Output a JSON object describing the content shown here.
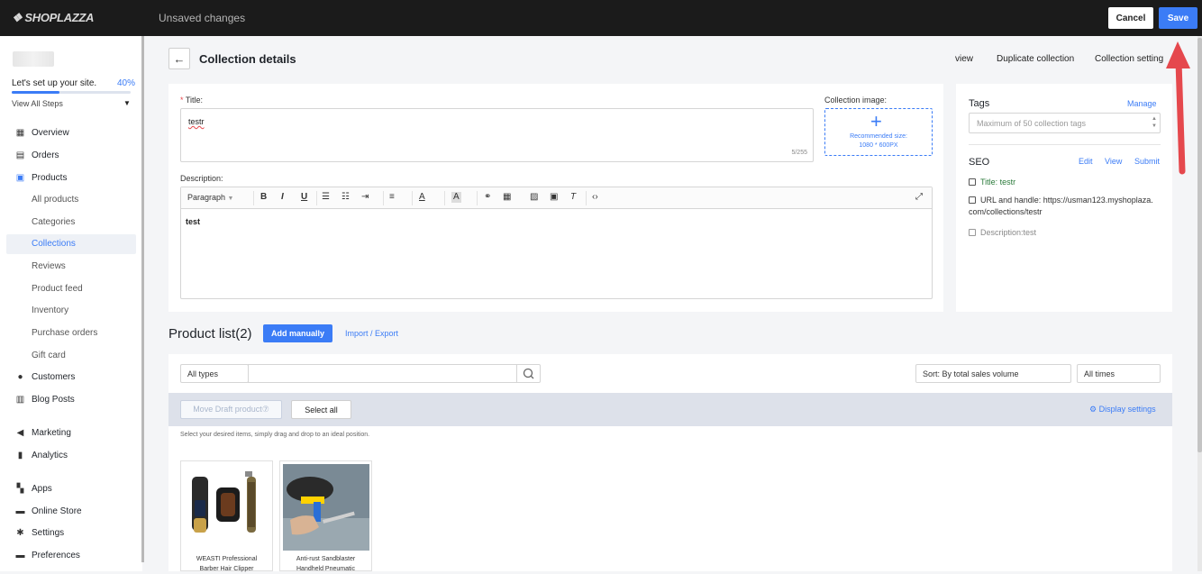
{
  "topbar": {
    "logo": "SHOPLAZZA",
    "status": "Unsaved changes",
    "cancel_label": "Cancel",
    "save_label": "Save",
    "accent": "#3b7cf6"
  },
  "sidebar": {
    "setup_text": "Let's set up your site.",
    "setup_percent_label": "40%",
    "setup_progress": 0.4,
    "view_steps": "View All Steps",
    "items": [
      {
        "label": "Overview",
        "icon": "overview-icon"
      },
      {
        "label": "Orders",
        "icon": "orders-icon"
      },
      {
        "label": "Products",
        "icon": "products-icon"
      },
      {
        "label": "All products"
      },
      {
        "label": "Categories"
      },
      {
        "label": "Collections",
        "active": true
      },
      {
        "label": "Reviews"
      },
      {
        "label": "Product feed"
      },
      {
        "label": "Inventory"
      },
      {
        "label": "Purchase orders"
      },
      {
        "label": "Gift card"
      },
      {
        "label": "Customers",
        "icon": "customers-icon"
      },
      {
        "label": "Blog Posts",
        "icon": "blog-icon"
      },
      {
        "label": "Marketing",
        "icon": "marketing-icon"
      },
      {
        "label": "Analytics",
        "icon": "analytics-icon"
      },
      {
        "label": "Apps",
        "icon": "apps-icon"
      },
      {
        "label": "Online Store",
        "icon": "store-icon"
      },
      {
        "label": "Settings",
        "icon": "settings-icon"
      },
      {
        "label": "Preferences",
        "icon": "preferences-icon"
      }
    ]
  },
  "header": {
    "title": "Collection details",
    "actions": [
      "view",
      "Duplicate collection",
      "Collection setting"
    ]
  },
  "form": {
    "title_label": "Title",
    "title_value": "testr",
    "title_counter": "5/255",
    "image_label": "Collection image",
    "image_hint_1": "Recommended size:",
    "image_hint_2": "1080 * 600PX",
    "description_label": "Description",
    "toolbar_paragraph": "Paragraph",
    "description_value": "test"
  },
  "side_panel": {
    "tags_label": "Tags",
    "tags_manage": "Manage",
    "tags_placeholder": "Maximum of 50 collection tags",
    "seo_label": "SEO",
    "seo_edit": "Edit",
    "seo_view": "View",
    "seo_submit": "Submit",
    "seo_title": "Title: testr",
    "seo_url_1": "URL and handle: https://usman123.myshoplaza.",
    "seo_url_2": "com/collections/testr",
    "seo_description": "Description:test"
  },
  "product_list": {
    "title": "Product list(2)",
    "add_manually": "Add manually",
    "import_export": "Import / Export",
    "type_filter": "All types",
    "search_value": "",
    "sort": "Sort: By total sales volume",
    "time_filter": "All times",
    "move_draft": "Move Draft product⑦",
    "select_all": "Select all",
    "display_settings": "Display settings",
    "hint": "Select your desired items, simply drag and drop to an ideal position.",
    "products": [
      {
        "name_1": "WEASTI Professional",
        "name_2": "Barber Hair Clipper"
      },
      {
        "name_1": "Anti-rust Sandblaster",
        "name_2": "Handheld Pneumatic"
      }
    ]
  }
}
